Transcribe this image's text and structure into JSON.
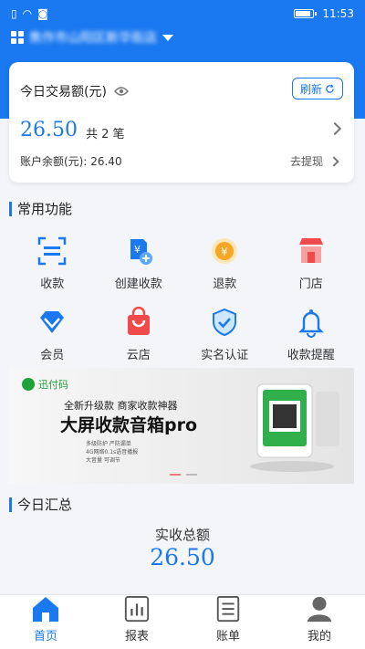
{
  "status_bar": {
    "time": "11:53"
  },
  "store": {
    "name": "焦作市山阳区新华街店"
  },
  "transaction_card": {
    "title": "今日交易额(元)",
    "refresh_label": "刷新",
    "amount": "26.50",
    "count": "共 2 笔",
    "balance": "账户余额(元): 26.40",
    "withdraw_label": "去提现"
  },
  "common_functions": {
    "title": "常用功能",
    "items": [
      {
        "label": "收款",
        "icon": "scan-icon"
      },
      {
        "label": "创建收款",
        "icon": "create-payment-icon"
      },
      {
        "label": "退款",
        "icon": "refund-icon"
      },
      {
        "label": "门店",
        "icon": "store-icon"
      },
      {
        "label": "会员",
        "icon": "member-diamond-icon"
      },
      {
        "label": "云店",
        "icon": "cloud-store-bag-icon"
      },
      {
        "label": "实名认证",
        "icon": "verify-shield-icon"
      },
      {
        "label": "收款提醒",
        "icon": "bell-icon"
      }
    ]
  },
  "banner": {
    "logo": "迅付码",
    "subtitle": "全新升级款  商家收款神器",
    "headline": "大屏收款音箱pro",
    "detail_1": "多级防护 严防漏单",
    "detail_2": "4G网络0.1s语音播报",
    "detail_3": "大音量 可调节"
  },
  "summary": {
    "title": "今日汇总",
    "total_label": "实收总额",
    "total_value": "26.50"
  },
  "tabbar": [
    {
      "label": "首页",
      "icon": "home-icon",
      "active": true
    },
    {
      "label": "报表",
      "icon": "report-icon",
      "active": false
    },
    {
      "label": "账单",
      "icon": "bill-icon",
      "active": false
    },
    {
      "label": "我的",
      "icon": "profile-icon",
      "active": false
    }
  ],
  "colors": {
    "brand_blue": "#1a78f0",
    "accent_red": "#f04a4a",
    "accent_orange": "#f5a623"
  }
}
